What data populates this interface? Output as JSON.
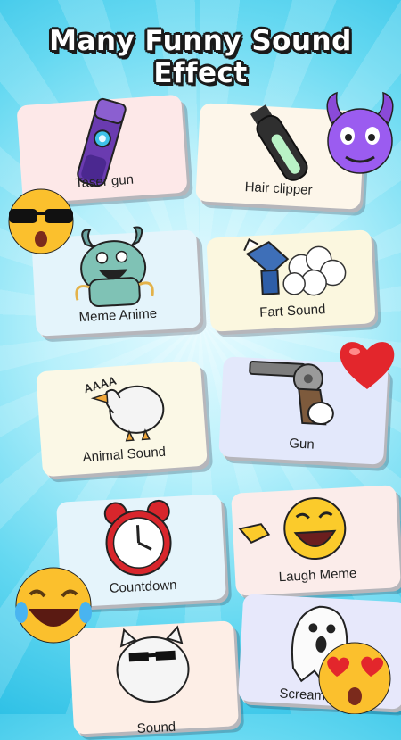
{
  "title": "Many Funny Sound Effect",
  "cards": [
    {
      "label": "Taser gun",
      "bg": "#fde8e8"
    },
    {
      "label": "Hair clipper",
      "bg": "#fdf6ea"
    },
    {
      "label": "Meme Anime",
      "bg": "#e4f4fb"
    },
    {
      "label": "Fart Sound",
      "bg": "#fbf7df"
    },
    {
      "label": "Animal Sound",
      "bg": "#fbf8e6"
    },
    {
      "label": "Gun",
      "bg": "#e3e8fb"
    },
    {
      "label": "Countdown",
      "bg": "#e5f4fb"
    },
    {
      "label": "Laugh Meme",
      "bg": "#fbecea"
    },
    {
      "label": "Sound",
      "bg": "#fdeee6"
    },
    {
      "label": "Scream",
      "bg": "#e7e8fb"
    }
  ],
  "decorations": [
    "devil-emoji",
    "sunglasses-emoji",
    "heart-emoji",
    "laughing-emoji",
    "heart-eyes-emoji"
  ]
}
